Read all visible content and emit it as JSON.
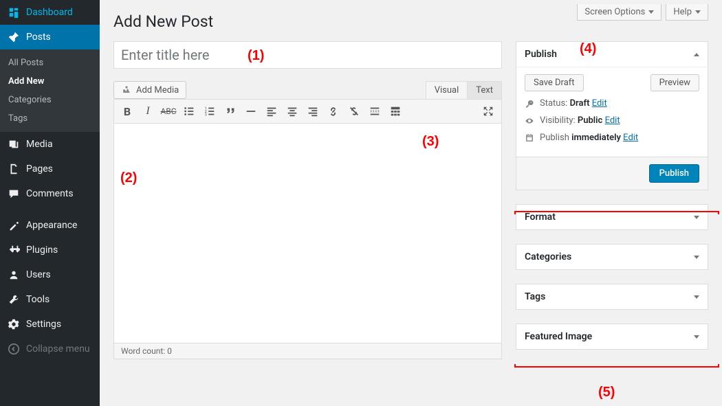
{
  "sidebar": {
    "items": [
      {
        "label": "Dashboard",
        "icon": "dashboard"
      },
      {
        "label": "Posts",
        "icon": "posts",
        "active": true
      },
      {
        "label": "Media",
        "icon": "media"
      },
      {
        "label": "Pages",
        "icon": "pages"
      },
      {
        "label": "Comments",
        "icon": "comments"
      },
      {
        "label": "Appearance",
        "icon": "appearance"
      },
      {
        "label": "Plugins",
        "icon": "plugins"
      },
      {
        "label": "Users",
        "icon": "users"
      },
      {
        "label": "Tools",
        "icon": "tools"
      },
      {
        "label": "Settings",
        "icon": "settings"
      }
    ],
    "submenu": [
      {
        "label": "All Posts"
      },
      {
        "label": "Add New",
        "current": true
      },
      {
        "label": "Categories"
      },
      {
        "label": "Tags"
      }
    ],
    "collapse_label": "Collapse menu"
  },
  "top": {
    "screen_options": "Screen Options",
    "help": "Help"
  },
  "page": {
    "title": "Add New Post"
  },
  "editor": {
    "title_placeholder": "Enter title here",
    "add_media": "Add Media",
    "tabs": {
      "visual": "Visual",
      "text": "Text"
    },
    "word_count": "Word count: 0"
  },
  "publish": {
    "heading": "Publish",
    "save_draft": "Save Draft",
    "preview": "Preview",
    "status_label": "Status:",
    "status_value": "Draft",
    "visibility_label": "Visibility:",
    "visibility_value": "Public",
    "schedule_label": "Publish",
    "schedule_value": "immediately",
    "edit": "Edit",
    "publish_btn": "Publish"
  },
  "boxes": {
    "format": "Format",
    "categories": "Categories",
    "tags": "Tags",
    "featured_image": "Featured Image"
  },
  "annotations": {
    "a1": "(1)",
    "a2": "(2)",
    "a3": "(3)",
    "a4": "(4)",
    "a5": "(5)"
  }
}
